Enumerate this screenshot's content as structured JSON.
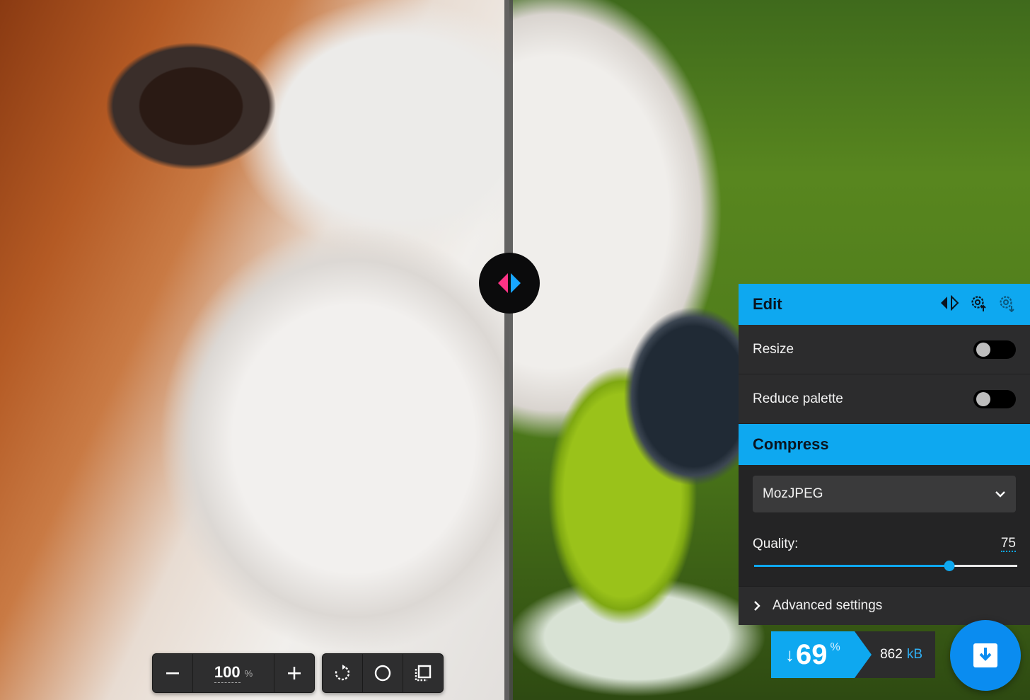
{
  "toolbar": {
    "zoom_value": "100",
    "zoom_unit": "%"
  },
  "edit": {
    "title": "Edit",
    "resize_label": "Resize",
    "resize_on": false,
    "reduce_palette_label": "Reduce palette",
    "reduce_palette_on": false
  },
  "compress": {
    "title": "Compress",
    "encoder_selected": "MozJPEG",
    "quality_label": "Quality:",
    "quality_value": "75",
    "quality_fraction": 0.75,
    "advanced_label": "Advanced settings"
  },
  "result": {
    "savings_arrow": "↓",
    "savings_value": "69",
    "savings_unit": "%",
    "size_value": "862",
    "size_unit": "kB"
  },
  "colors": {
    "accent": "#0ea8f0",
    "panel_bg": "#2c2c2d",
    "compare_left": "#ff3385",
    "compare_right": "#18a6ff"
  },
  "icons": {
    "compare": "compare-arrows-icon",
    "import_settings": "gear-upload-icon",
    "export_settings": "gear-download-icon",
    "zoom_out": "minus-icon",
    "zoom_in": "plus-icon",
    "rotate": "rotate-icon",
    "background": "circle-icon",
    "crop": "crop-icon",
    "chevron": "chevron-down-icon",
    "expand": "chevron-right-icon",
    "download": "download-icon"
  }
}
